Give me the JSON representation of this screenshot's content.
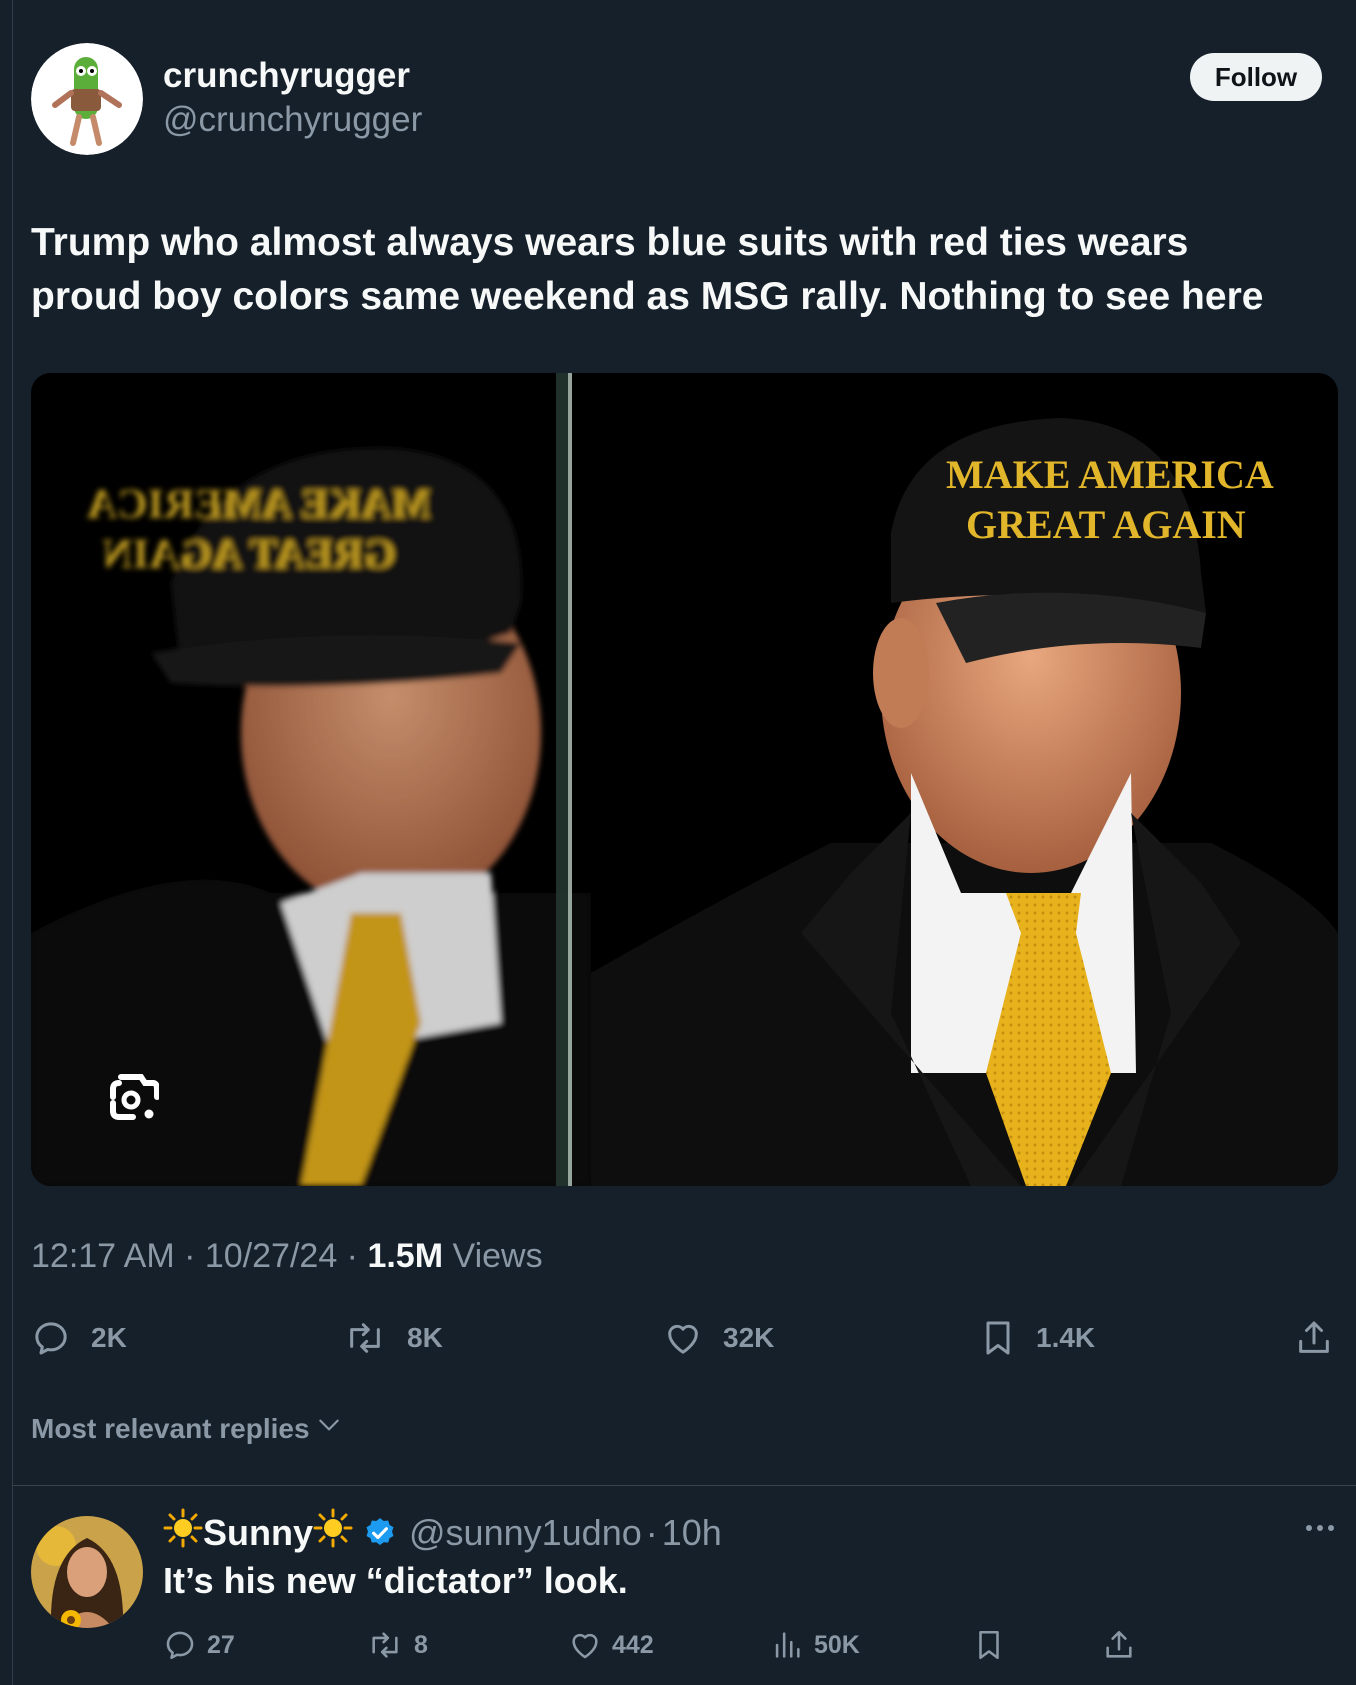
{
  "author": {
    "display_name": "crunchyrugger",
    "handle": "@crunchyrugger",
    "avatar": "pickle-character-avatar"
  },
  "follow_label": "Follow",
  "tweet": {
    "text_line1": "Trump who almost always wears blue suits with red ties wears",
    "text_line2": "proud boy colors same weekend as MSG rally. Nothing to see here",
    "media_icon": "google-lens-icon",
    "media": {
      "description": "Two photos side by side of a man in a black cap, dark coat and gold tie",
      "hat_text_line1": "MAKE AMERICA",
      "hat_text_line2": "GREAT AGAIN",
      "tie_color": "#e8b21c"
    },
    "time": "12:17 AM",
    "date": "10/27/24",
    "views_count": "1.5M",
    "views_label": "Views",
    "separator": " · "
  },
  "actions": {
    "replies": "2K",
    "reposts": "8K",
    "likes": "32K",
    "bookmarks": "1.4K"
  },
  "replies_sort_label": "Most relevant replies",
  "reply": {
    "display_name_prefix_icon": "sun-emoji",
    "display_name": "Sunny",
    "verified_icon": "verified-badge-icon",
    "handle": "@sunny1udno",
    "time": "10h",
    "separator": "·",
    "text": "It’s his new “dictator” look.",
    "actions": {
      "replies": "27",
      "reposts": "8",
      "likes": "442",
      "views": "50K"
    }
  },
  "colors": {
    "background": "#15202b",
    "primary_text": "#f7f9f9",
    "secondary_text": "#8b98a5",
    "verified_blue": "#1d9bf0",
    "follow_button_bg": "#eff3f4"
  }
}
